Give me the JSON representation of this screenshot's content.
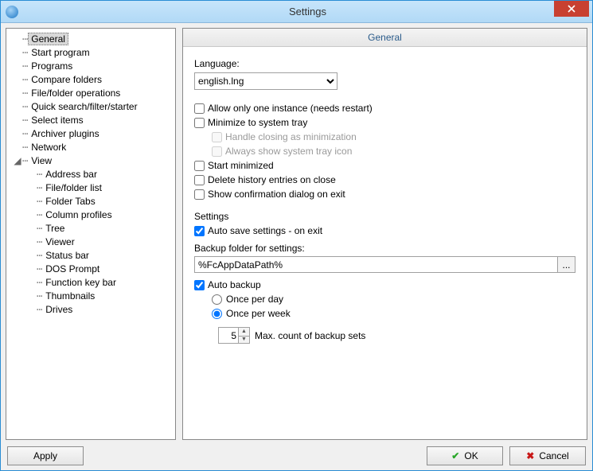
{
  "window": {
    "title": "Settings"
  },
  "tree": {
    "items": [
      {
        "label": "General",
        "depth": 0,
        "selected": true
      },
      {
        "label": "Start program",
        "depth": 0
      },
      {
        "label": "Programs",
        "depth": 0
      },
      {
        "label": "Compare folders",
        "depth": 0
      },
      {
        "label": "File/folder operations",
        "depth": 0
      },
      {
        "label": "Quick search/filter/starter",
        "depth": 0
      },
      {
        "label": "Select items",
        "depth": 0
      },
      {
        "label": "Archiver plugins",
        "depth": 0
      },
      {
        "label": "Network",
        "depth": 0
      },
      {
        "label": "View",
        "depth": 0,
        "expandable": true,
        "expanded": true
      },
      {
        "label": "Address bar",
        "depth": 1
      },
      {
        "label": "File/folder list",
        "depth": 1
      },
      {
        "label": "Folder Tabs",
        "depth": 1
      },
      {
        "label": "Column profiles",
        "depth": 1
      },
      {
        "label": "Tree",
        "depth": 1
      },
      {
        "label": "Viewer",
        "depth": 1
      },
      {
        "label": "Status bar",
        "depth": 1
      },
      {
        "label": "DOS Prompt",
        "depth": 1
      },
      {
        "label": "Function key bar",
        "depth": 1
      },
      {
        "label": "Thumbnails",
        "depth": 1
      },
      {
        "label": "Drives",
        "depth": 1
      }
    ]
  },
  "panel": {
    "title": "General",
    "language_label": "Language:",
    "language_value": "english.lng",
    "chk_one_instance": "Allow only one instance (needs restart)",
    "chk_min_tray": "Minimize to system tray",
    "chk_handle_close": "Handle closing as minimization",
    "chk_always_tray": "Always show system tray icon",
    "chk_start_min": "Start minimized",
    "chk_del_history": "Delete history entries on close",
    "chk_confirm_exit": "Show confirmation dialog on exit",
    "settings_label": "Settings",
    "chk_autosave": "Auto save settings - on exit",
    "backup_label": "Backup folder for settings:",
    "backup_path": "%FcAppDataPath%",
    "browse": "...",
    "chk_autobackup": "Auto backup",
    "radio_once_day": "Once per day",
    "radio_once_week": "Once per week",
    "max_count": "5",
    "max_count_label": "Max. count of backup sets"
  },
  "footer": {
    "apply": "Apply",
    "ok": "OK",
    "cancel": "Cancel"
  }
}
